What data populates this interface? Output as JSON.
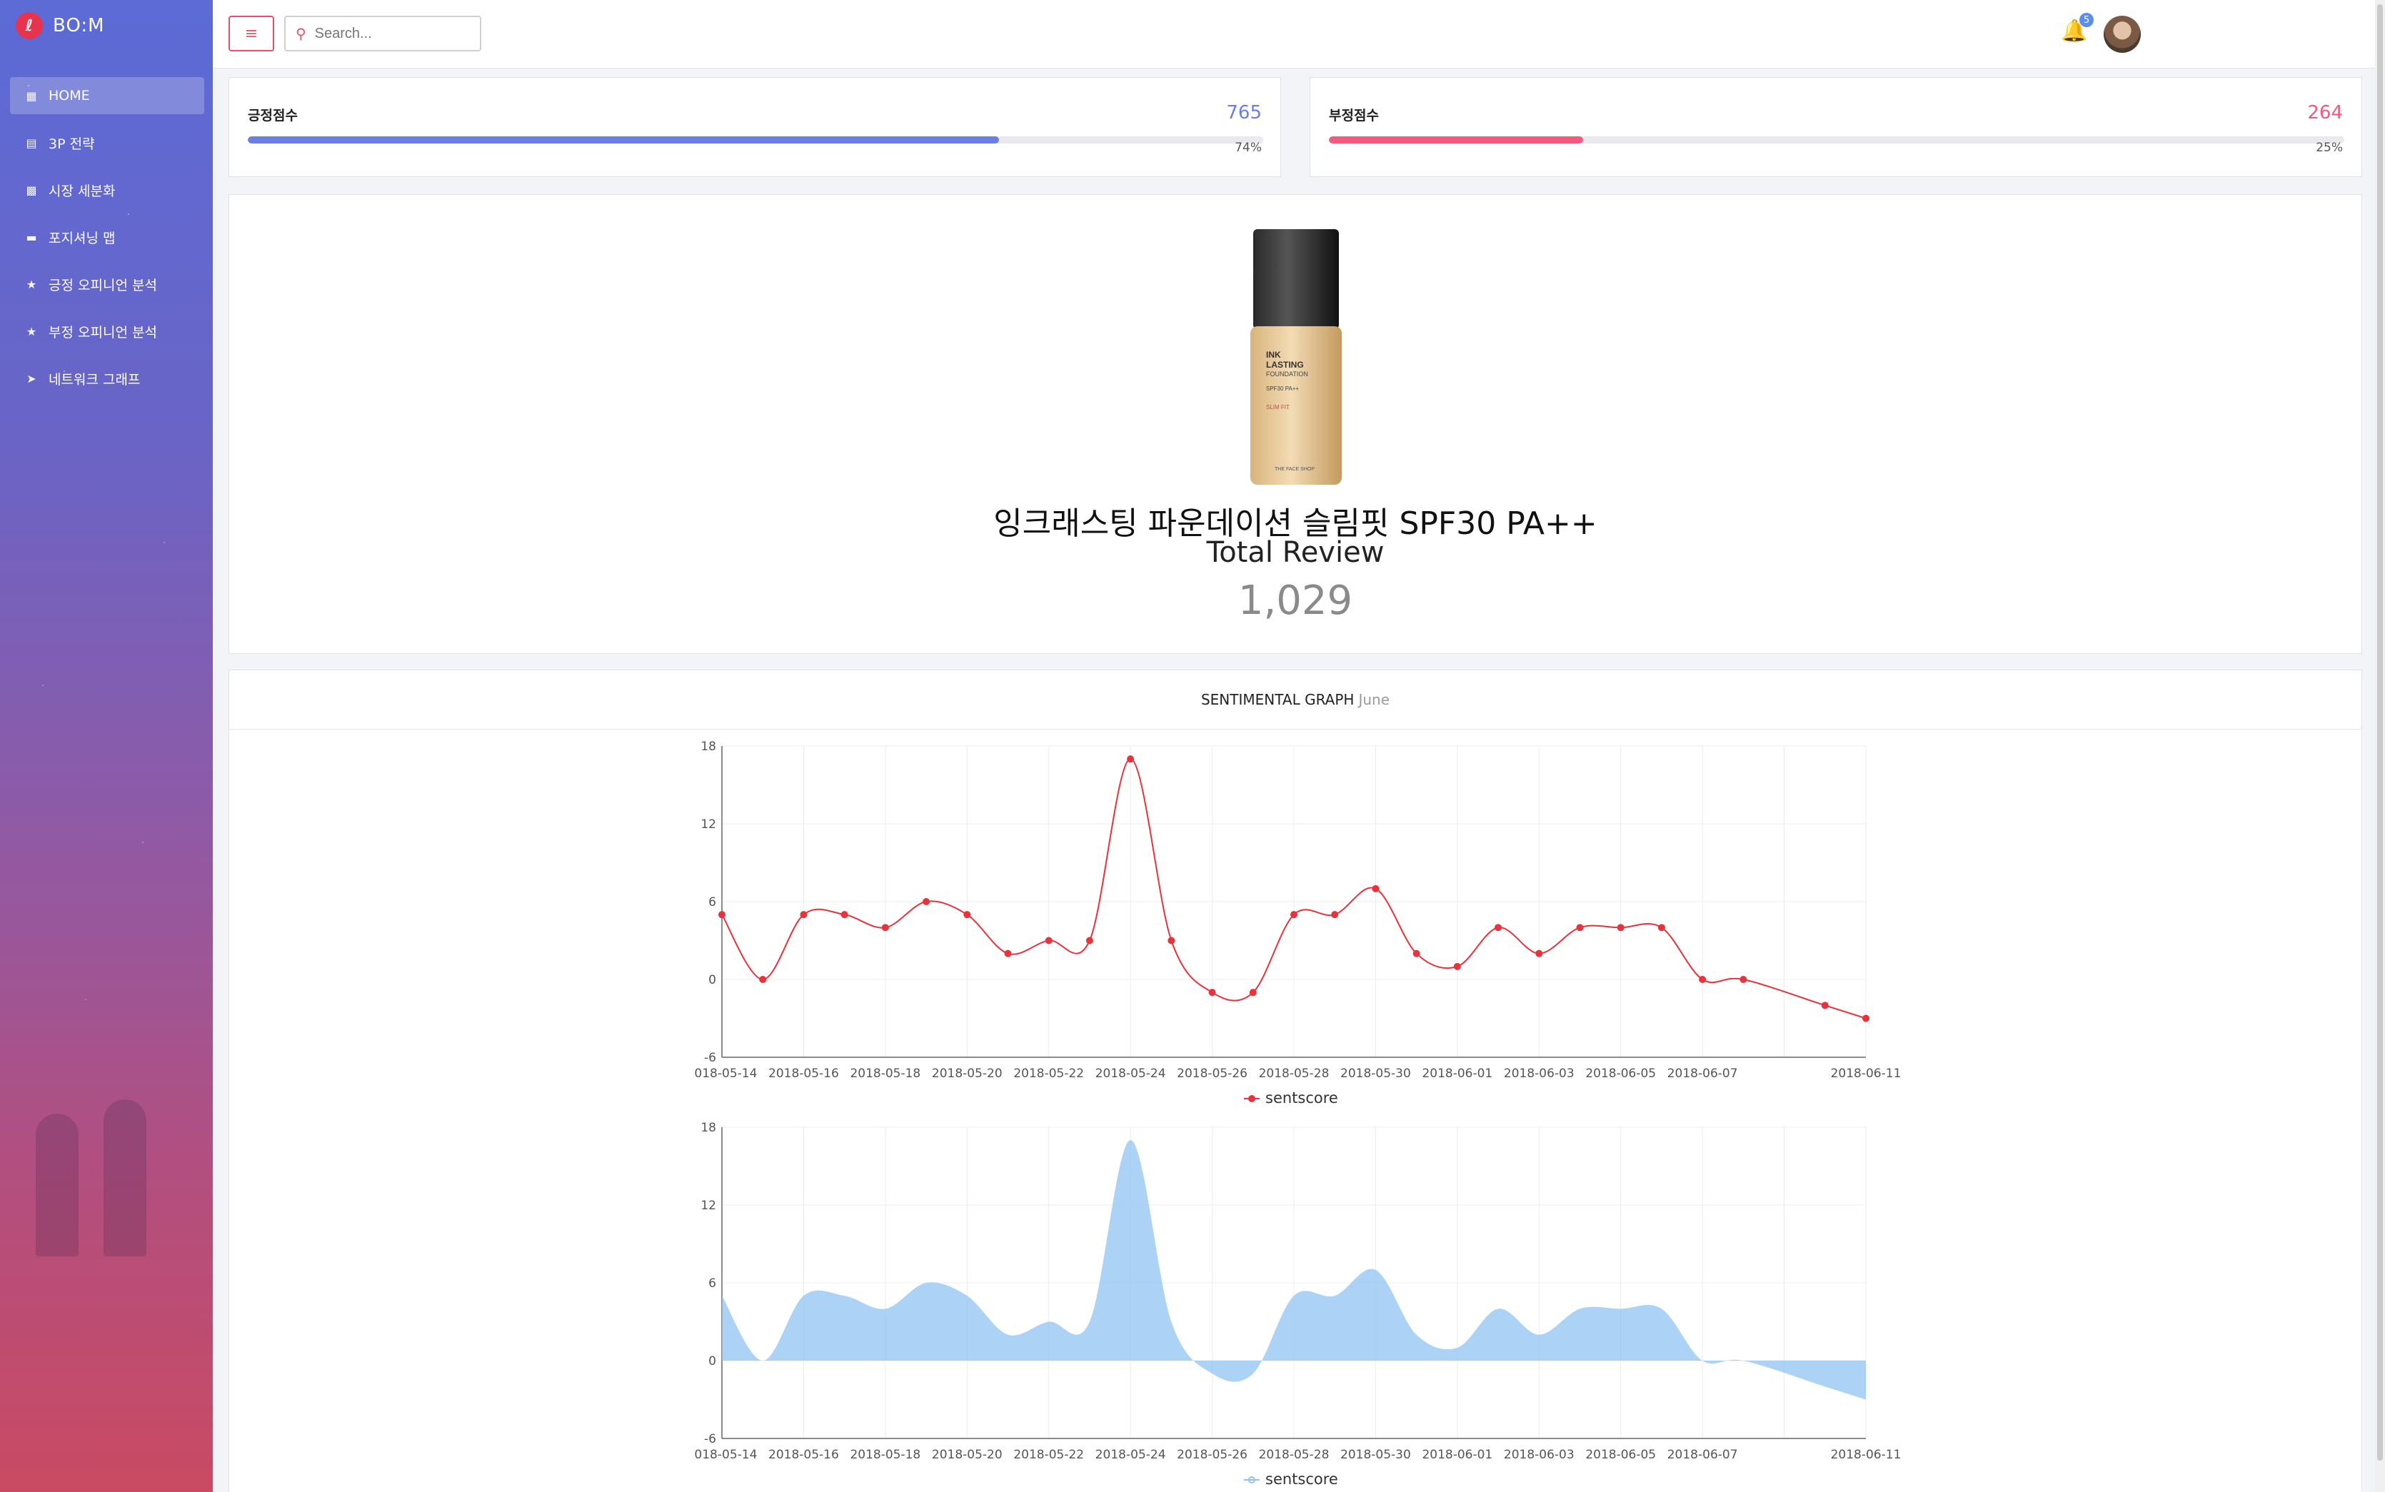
{
  "brand": {
    "name": "BO:M",
    "logo_icon": "thermometer-icon"
  },
  "sidebar": {
    "items": [
      {
        "label": "HOME",
        "icon": "dashboard-icon",
        "active": true
      },
      {
        "label": "3P 전략",
        "icon": "table-icon"
      },
      {
        "label": "시장 세분화",
        "icon": "chart-icon"
      },
      {
        "label": "포지셔닝 맵",
        "icon": "layers-icon"
      },
      {
        "label": "긍정 오피니언 분석",
        "icon": "star-icon"
      },
      {
        "label": "부정 오피니언 분석",
        "icon": "star-icon"
      },
      {
        "label": "네트워크 그래프",
        "icon": "send-icon"
      }
    ]
  },
  "topbar": {
    "search_placeholder": "Search...",
    "notification_count": "5"
  },
  "stats": {
    "positive": {
      "title": "긍정점수",
      "value": "765",
      "percent_label": "74%",
      "fill": 0.74,
      "color": "#6b7fe3"
    },
    "negative": {
      "title": "부정점수",
      "value": "264",
      "percent_label": "25%",
      "fill": 0.25,
      "color": "#f25a7e"
    }
  },
  "product": {
    "name": "잉크래스팅 파운데이션 슬림핏 SPF30 PA++",
    "subtitle": "Total Review",
    "count": "1,029",
    "bottle_text": [
      "INK",
      "LASTING",
      "FOUNDATION",
      "SPF30 PA++",
      "SLIM FIT",
      "THE FACE SHOP"
    ]
  },
  "graph": {
    "title": "SENTIMENTAL GRAPH",
    "subtitle": "June"
  },
  "chart_data": [
    {
      "type": "line",
      "x": [
        "2018-05-14",
        "2018-05-15",
        "2018-05-16",
        "2018-05-17",
        "2018-05-18",
        "2018-05-19",
        "2018-05-20",
        "2018-05-21",
        "2018-05-22",
        "2018-05-23",
        "2018-05-24",
        "2018-05-25",
        "2018-05-26",
        "2018-05-27",
        "2018-05-28",
        "2018-05-29",
        "2018-05-30",
        "2018-05-31",
        "2018-06-01",
        "2018-06-02",
        "2018-06-03",
        "2018-06-04",
        "2018-06-05",
        "2018-06-06",
        "2018-06-07",
        "2018-06-08",
        "2018-06-10",
        "2018-06-11"
      ],
      "series": [
        {
          "name": "sentscore",
          "values": [
            5,
            0,
            5,
            5,
            4,
            6,
            5,
            2,
            3,
            3,
            17,
            3,
            -1,
            -1,
            5,
            5,
            7,
            2,
            1,
            4,
            2,
            4,
            4,
            4,
            0,
            0,
            -2,
            -3
          ],
          "color": "#e8323c"
        }
      ],
      "xticks": [
        "2018-05-14",
        "2018-05-16",
        "2018-05-18",
        "2018-05-20",
        "2018-05-22",
        "2018-05-24",
        "2018-05-26",
        "2018-05-28",
        "2018-05-30",
        "2018-06-01",
        "2018-06-03",
        "2018-06-05",
        "2018-06-07",
        "2018-06-11"
      ],
      "yticks": [
        -6,
        0,
        6,
        12,
        18
      ],
      "ylim": [
        -6,
        18
      ],
      "grid": true,
      "legend": "bottom-center"
    },
    {
      "type": "area",
      "x": [
        "2018-05-14",
        "2018-05-15",
        "2018-05-16",
        "2018-05-17",
        "2018-05-18",
        "2018-05-19",
        "2018-05-20",
        "2018-05-21",
        "2018-05-22",
        "2018-05-23",
        "2018-05-24",
        "2018-05-25",
        "2018-05-26",
        "2018-05-27",
        "2018-05-28",
        "2018-05-29",
        "2018-05-30",
        "2018-05-31",
        "2018-06-01",
        "2018-06-02",
        "2018-06-03",
        "2018-06-04",
        "2018-06-05",
        "2018-06-06",
        "2018-06-07",
        "2018-06-08",
        "2018-06-10",
        "2018-06-11"
      ],
      "series": [
        {
          "name": "sentscore",
          "values": [
            5,
            0,
            5,
            5,
            4,
            6,
            5,
            2,
            3,
            3,
            17,
            3,
            -1,
            -1,
            5,
            5,
            7,
            2,
            1,
            4,
            2,
            4,
            4,
            4,
            0,
            0,
            -2,
            -3
          ],
          "color": "#90c3f2"
        }
      ],
      "xticks": [
        "2018-05-14",
        "2018-05-16",
        "2018-05-18",
        "2018-05-20",
        "2018-05-22",
        "2018-05-24",
        "2018-05-26",
        "2018-05-28",
        "2018-05-30",
        "2018-06-01",
        "2018-06-03",
        "2018-06-05",
        "2018-06-07",
        "2018-06-11"
      ],
      "yticks": [
        -6,
        0,
        6,
        12,
        18
      ],
      "ylim": [
        -6,
        18
      ],
      "grid": true,
      "legend": "bottom-center"
    }
  ]
}
